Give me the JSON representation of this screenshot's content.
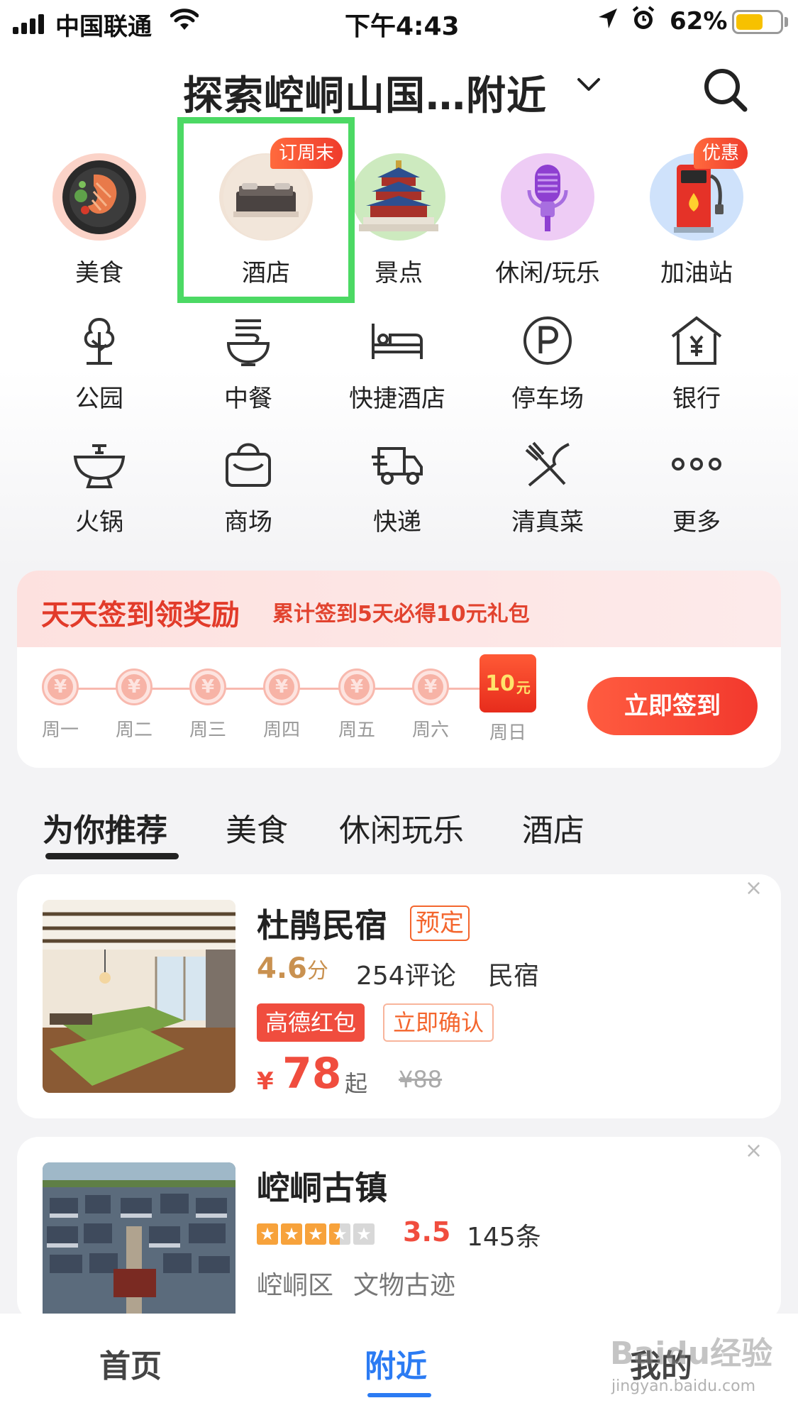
{
  "status_bar": {
    "carrier": "中国联通",
    "time": "下午4:43",
    "battery_pct": "62%",
    "battery_level": 0.62,
    "battery_color": "#f7c100"
  },
  "header": {
    "title": "探索崆峒山国…附近",
    "search_icon": "search-icon"
  },
  "top_categories": [
    {
      "label": "美食",
      "icon": "food-icon"
    },
    {
      "label": "酒店",
      "icon": "hotel-icon",
      "badge": "订周末",
      "highlighted": true
    },
    {
      "label": "景点",
      "icon": "attraction-icon"
    },
    {
      "label": "休闲/玩乐",
      "icon": "microphone-icon"
    },
    {
      "label": "加油站",
      "icon": "gas-station-icon",
      "badge": "优惠"
    }
  ],
  "icon_grid": [
    {
      "label": "公园",
      "icon": "tree-icon"
    },
    {
      "label": "中餐",
      "icon": "noodle-bowl-icon"
    },
    {
      "label": "快捷酒店",
      "icon": "bed-icon"
    },
    {
      "label": "停车场",
      "icon": "parking-icon"
    },
    {
      "label": "银行",
      "icon": "bank-icon"
    },
    {
      "label": "火锅",
      "icon": "hotpot-icon"
    },
    {
      "label": "商场",
      "icon": "shopping-bag-icon"
    },
    {
      "label": "快递",
      "icon": "delivery-truck-icon"
    },
    {
      "label": "清真菜",
      "icon": "fork-knife-icon"
    },
    {
      "label": "更多",
      "icon": "more-dots-icon"
    }
  ],
  "signin": {
    "title": "天天签到领奖励",
    "subtitle": "累计签到5天必得10元礼包",
    "coin_symbol": "¥",
    "days": [
      "周一",
      "周二",
      "周三",
      "周四",
      "周五",
      "周六",
      "周日"
    ],
    "reward_amount": "10",
    "reward_unit": "元",
    "button": "立即签到"
  },
  "tabs": [
    {
      "label": "为你推荐",
      "active": true
    },
    {
      "label": "美食"
    },
    {
      "label": "休闲玩乐"
    },
    {
      "label": "酒店"
    }
  ],
  "listings": [
    {
      "title": "杜鹃民宿",
      "tag": "预定",
      "score": "4.6",
      "score_unit": "分",
      "reviews": "254评论",
      "category": "民宿",
      "badge_red": "高德红包",
      "badge_outline": "立即确认",
      "price_symbol": "¥",
      "price": "78",
      "price_suffix": "起",
      "original_price": "¥88",
      "close": "×"
    },
    {
      "title": "崆峒古镇",
      "rating": 3.5,
      "rating_text": "3.5",
      "reviews": "145条",
      "district": "崆峒区",
      "category": "文物古迹",
      "close": "×"
    }
  ],
  "bottom_nav": [
    {
      "label": "首页"
    },
    {
      "label": "附近",
      "active": true
    },
    {
      "label": "我的"
    }
  ],
  "watermark": {
    "text": "Baidu经验",
    "sub": "jingyan.baidu.com"
  },
  "colors": {
    "accent_red": "#f04d3e",
    "active_blue": "#2b7bf3",
    "highlight_green": "#4cd964",
    "gold_score": "#c99150"
  }
}
